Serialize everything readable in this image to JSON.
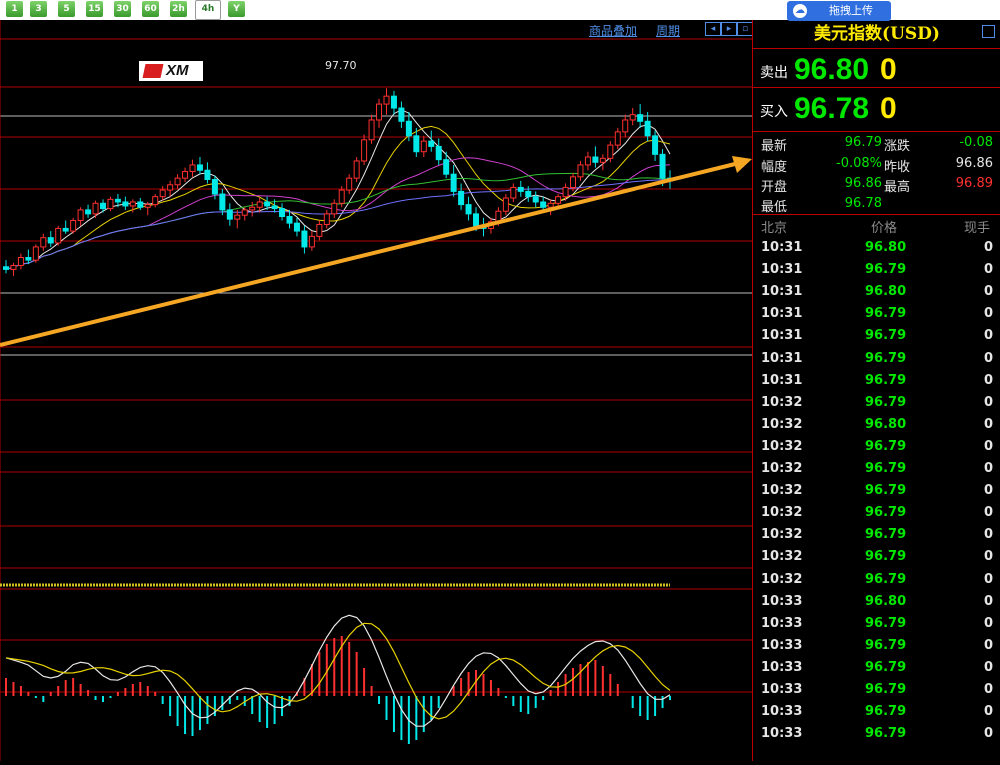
{
  "timeframes": [
    "1",
    "3",
    "5",
    "15",
    "30",
    "60",
    "2h",
    "4h",
    "Y"
  ],
  "upload_button": "拖拽上传",
  "chart_toolbar": {
    "overlay": "商品叠加",
    "period": "周期"
  },
  "peak_label": "97.70",
  "logo_text": "XM",
  "panel": {
    "title": "美元指数(USD)",
    "sell_label": "卖出",
    "sell_price": "96.80",
    "sell_volume": "0",
    "buy_label": "买入",
    "buy_price": "96.78",
    "buy_volume": "0",
    "stats": {
      "last_label": "最新",
      "last": "96.79",
      "change_label": "涨跌",
      "change": "-0.08",
      "range_label": "幅度",
      "range": "-0.08%",
      "prev_close_label": "昨收",
      "prev_close": "96.86",
      "open_label": "开盘",
      "open": "96.86",
      "high_label": "最高",
      "high": "96.89",
      "low_label": "最低",
      "low": "96.78"
    },
    "ticks_header": {
      "time": "北京",
      "price": "价格",
      "volume": "现手"
    },
    "ticks": [
      {
        "time": "10:31",
        "price": "96.80",
        "vol": "0"
      },
      {
        "time": "10:31",
        "price": "96.79",
        "vol": "0"
      },
      {
        "time": "10:31",
        "price": "96.80",
        "vol": "0"
      },
      {
        "time": "10:31",
        "price": "96.79",
        "vol": "0"
      },
      {
        "time": "10:31",
        "price": "96.79",
        "vol": "0"
      },
      {
        "time": "10:31",
        "price": "96.79",
        "vol": "0"
      },
      {
        "time": "10:31",
        "price": "96.79",
        "vol": "0"
      },
      {
        "time": "10:32",
        "price": "96.79",
        "vol": "0"
      },
      {
        "time": "10:32",
        "price": "96.80",
        "vol": "0"
      },
      {
        "time": "10:32",
        "price": "96.79",
        "vol": "0"
      },
      {
        "time": "10:32",
        "price": "96.79",
        "vol": "0"
      },
      {
        "time": "10:32",
        "price": "96.79",
        "vol": "0"
      },
      {
        "time": "10:32",
        "price": "96.79",
        "vol": "0"
      },
      {
        "time": "10:32",
        "price": "96.79",
        "vol": "0"
      },
      {
        "time": "10:32",
        "price": "96.79",
        "vol": "0"
      },
      {
        "time": "10:32",
        "price": "96.79",
        "vol": "0"
      },
      {
        "time": "10:33",
        "price": "96.80",
        "vol": "0"
      },
      {
        "time": "10:33",
        "price": "96.79",
        "vol": "0"
      },
      {
        "time": "10:33",
        "price": "96.79",
        "vol": "0"
      },
      {
        "time": "10:33",
        "price": "96.79",
        "vol": "0"
      },
      {
        "time": "10:33",
        "price": "96.79",
        "vol": "0"
      },
      {
        "time": "10:33",
        "price": "96.79",
        "vol": "0"
      },
      {
        "time": "10:33",
        "price": "96.79",
        "vol": "0"
      }
    ]
  },
  "colors": {
    "up": "#ff3030",
    "down": "#00e8e8",
    "trendline": "#f5a623",
    "grid": "#b00000"
  },
  "candles": [
    [
      96.35,
      96.4,
      96.3,
      96.33
    ],
    [
      96.33,
      96.38,
      96.28,
      96.36
    ],
    [
      96.36,
      96.45,
      96.33,
      96.42
    ],
    [
      96.42,
      96.48,
      96.37,
      96.4
    ],
    [
      96.4,
      96.52,
      96.38,
      96.5
    ],
    [
      96.5,
      96.6,
      96.47,
      96.57
    ],
    [
      96.57,
      96.62,
      96.5,
      96.53
    ],
    [
      96.53,
      96.66,
      96.51,
      96.64
    ],
    [
      96.64,
      96.7,
      96.6,
      96.62
    ],
    [
      96.62,
      96.72,
      96.6,
      96.7
    ],
    [
      96.7,
      96.8,
      96.66,
      96.78
    ],
    [
      96.78,
      96.82,
      96.72,
      96.75
    ],
    [
      96.75,
      96.85,
      96.72,
      96.83
    ],
    [
      96.83,
      96.86,
      96.76,
      96.79
    ],
    [
      96.79,
      96.88,
      96.77,
      96.86
    ],
    [
      96.86,
      96.9,
      96.8,
      96.84
    ],
    [
      96.84,
      96.88,
      96.78,
      96.81
    ],
    [
      96.81,
      96.86,
      96.76,
      96.84
    ],
    [
      96.84,
      96.87,
      96.78,
      96.8
    ],
    [
      96.8,
      96.84,
      96.74,
      96.82
    ],
    [
      96.82,
      96.9,
      96.8,
      96.88
    ],
    [
      96.88,
      96.96,
      96.85,
      96.93
    ],
    [
      96.93,
      97.0,
      96.88,
      96.97
    ],
    [
      96.97,
      97.05,
      96.94,
      97.02
    ],
    [
      97.02,
      97.1,
      96.99,
      97.07
    ],
    [
      97.07,
      97.16,
      97.03,
      97.12
    ],
    [
      97.12,
      97.18,
      97.05,
      97.08
    ],
    [
      97.08,
      97.14,
      96.98,
      97.01
    ],
    [
      97.01,
      97.04,
      96.86,
      96.9
    ],
    [
      96.9,
      96.94,
      96.74,
      96.78
    ],
    [
      96.78,
      96.83,
      96.66,
      96.71
    ],
    [
      96.71,
      96.78,
      96.64,
      96.74
    ],
    [
      96.74,
      96.8,
      96.7,
      96.78
    ],
    [
      96.78,
      96.84,
      96.73,
      96.8
    ],
    [
      96.8,
      96.87,
      96.76,
      96.84
    ],
    [
      96.84,
      96.88,
      96.78,
      96.81
    ],
    [
      96.81,
      96.86,
      96.76,
      96.79
    ],
    [
      96.79,
      96.83,
      96.7,
      96.73
    ],
    [
      96.73,
      96.78,
      96.64,
      96.68
    ],
    [
      96.68,
      96.72,
      96.58,
      96.62
    ],
    [
      96.62,
      96.66,
      96.45,
      96.5
    ],
    [
      96.5,
      96.62,
      96.47,
      96.58
    ],
    [
      96.58,
      96.7,
      96.55,
      96.67
    ],
    [
      96.67,
      96.78,
      96.64,
      96.75
    ],
    [
      96.75,
      96.86,
      96.72,
      96.83
    ],
    [
      96.83,
      96.96,
      96.8,
      96.93
    ],
    [
      96.93,
      97.05,
      96.9,
      97.02
    ],
    [
      97.02,
      97.18,
      96.99,
      97.15
    ],
    [
      97.15,
      97.35,
      97.12,
      97.31
    ],
    [
      97.31,
      97.5,
      97.28,
      97.46
    ],
    [
      97.46,
      97.62,
      97.4,
      97.58
    ],
    [
      97.58,
      97.7,
      97.5,
      97.64
    ],
    [
      97.64,
      97.68,
      97.5,
      97.55
    ],
    [
      97.55,
      97.6,
      97.4,
      97.45
    ],
    [
      97.45,
      97.52,
      97.3,
      97.34
    ],
    [
      97.34,
      97.4,
      97.18,
      97.22
    ],
    [
      97.22,
      97.34,
      97.18,
      97.3
    ],
    [
      97.3,
      97.38,
      97.22,
      97.26
    ],
    [
      97.26,
      97.32,
      97.12,
      97.16
    ],
    [
      97.16,
      97.22,
      97.02,
      97.05
    ],
    [
      97.05,
      97.12,
      96.88,
      96.92
    ],
    [
      96.92,
      96.98,
      96.78,
      96.82
    ],
    [
      96.82,
      96.88,
      96.7,
      96.75
    ],
    [
      96.75,
      96.8,
      96.62,
      96.66
    ],
    [
      96.66,
      96.72,
      96.58,
      96.64
    ],
    [
      96.64,
      96.72,
      96.6,
      96.69
    ],
    [
      96.69,
      96.8,
      96.66,
      96.77
    ],
    [
      96.77,
      96.9,
      96.74,
      96.87
    ],
    [
      96.87,
      96.98,
      96.84,
      96.95
    ],
    [
      96.95,
      97.0,
      96.88,
      96.92
    ],
    [
      96.92,
      96.96,
      96.84,
      96.88
    ],
    [
      96.88,
      96.92,
      96.8,
      96.84
    ],
    [
      96.84,
      96.88,
      96.76,
      96.8
    ],
    [
      96.8,
      96.86,
      96.74,
      96.83
    ],
    [
      96.83,
      96.9,
      96.8,
      96.88
    ],
    [
      96.88,
      96.98,
      96.85,
      96.95
    ],
    [
      96.95,
      97.06,
      96.92,
      97.03
    ],
    [
      97.03,
      97.15,
      97.0,
      97.12
    ],
    [
      97.12,
      97.22,
      97.08,
      97.18
    ],
    [
      97.18,
      97.26,
      97.1,
      97.14
    ],
    [
      97.14,
      97.2,
      97.08,
      97.17
    ],
    [
      97.17,
      97.3,
      97.14,
      97.27
    ],
    [
      97.27,
      97.4,
      97.24,
      97.37
    ],
    [
      97.37,
      97.5,
      97.33,
      97.46
    ],
    [
      97.46,
      97.55,
      97.42,
      97.5
    ],
    [
      97.5,
      97.58,
      97.4,
      97.45
    ],
    [
      97.45,
      97.52,
      97.3,
      97.34
    ],
    [
      97.34,
      97.38,
      97.15,
      97.2
    ],
    [
      97.2,
      97.24,
      96.96,
      97.02
    ],
    [
      97.02,
      97.08,
      96.94,
      97.0
    ]
  ],
  "macd": [
    0.9,
    0.7,
    0.5,
    0.2,
    -0.1,
    -0.3,
    0.2,
    0.5,
    0.8,
    0.9,
    0.6,
    0.3,
    -0.2,
    -0.3,
    -0.1,
    0.2,
    0.4,
    0.6,
    0.7,
    0.5,
    0.2,
    -0.4,
    -1.0,
    -1.5,
    -1.9,
    -2.0,
    -1.7,
    -1.4,
    -1.0,
    -0.7,
    -0.4,
    -0.2,
    -0.5,
    -0.9,
    -1.3,
    -1.6,
    -1.4,
    -1.0,
    -0.5,
    0.2,
    0.9,
    1.6,
    2.2,
    2.6,
    2.9,
    3.0,
    2.7,
    2.2,
    1.4,
    0.5,
    -0.4,
    -1.2,
    -1.8,
    -2.2,
    -2.4,
    -2.2,
    -1.8,
    -1.2,
    -0.6,
    0.0,
    0.5,
    0.9,
    1.2,
    1.3,
    1.1,
    0.8,
    0.4,
    -0.1,
    -0.5,
    -0.8,
    -0.9,
    -0.6,
    -0.2,
    0.3,
    0.7,
    1.1,
    1.4,
    1.6,
    1.7,
    1.8,
    1.5,
    1.1,
    0.6,
    0.0,
    -0.6,
    -1.0,
    -1.2,
    -1.0,
    -0.6,
    -0.2
  ]
}
